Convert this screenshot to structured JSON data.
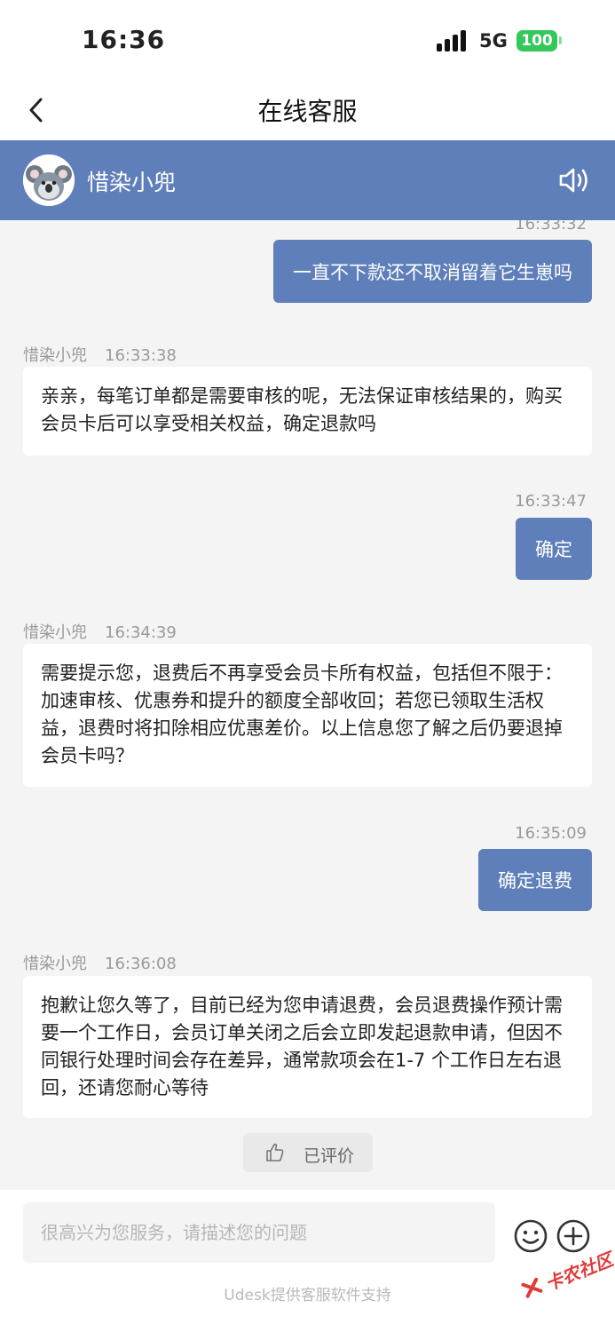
{
  "status_bar": {
    "time": "16:36",
    "network": "5G",
    "battery": "100"
  },
  "nav": {
    "title": "在线客服"
  },
  "agent": {
    "name": "惜染小兜"
  },
  "messages": [
    {
      "side": "right",
      "time": "16:33:32",
      "text": "一直不下款还不取消留着它生崽吗"
    },
    {
      "side": "left",
      "sender": "惜染小兜",
      "time": "16:33:38",
      "text": "亲亲，每笔订单都是需要审核的呢，无法保证审核结果的，购买会员卡后可以享受相关权益，确定退款吗"
    },
    {
      "side": "right",
      "time": "16:33:47",
      "text": "确定"
    },
    {
      "side": "left",
      "sender": "惜染小兜",
      "time": "16:34:39",
      "text": "需要提示您，退费后不再享受会员卡所有权益，包括但不限于：加速审核、优惠券和提升的额度全部收回；若您已领取生活权益，退费时将扣除相应优惠差价。以上信息您了解之后仍要退掉会员卡吗？"
    },
    {
      "side": "right",
      "time": "16:35:09",
      "text": "确定退费"
    },
    {
      "side": "left",
      "sender": "惜染小兜",
      "time": "16:36:08",
      "text": "抱歉让您久等了，目前已经为您申请退费，会员退费操作预计需要一个工作日，会员订单关闭之后会立即发起退款申请，但因不同银行处理时间会存在差异，通常款项会在1-7 个工作日左右退回，还请您耐心等待"
    }
  ],
  "rating": {
    "label": "已评价"
  },
  "input": {
    "placeholder": "很高兴为您服务，请描述您的问题",
    "value": ""
  },
  "footer": {
    "powered_by": "Udesk提供客服软件支持"
  },
  "watermark": {
    "text": "卡农社区"
  },
  "colors": {
    "accent": "#5f7fba",
    "background": "#f4f4f5",
    "battery": "#34c759"
  },
  "icons": [
    "back-arrow-icon",
    "koala-avatar-icon",
    "speaker-icon",
    "thumbs-up-icon",
    "emoji-icon",
    "plus-circle-icon"
  ]
}
